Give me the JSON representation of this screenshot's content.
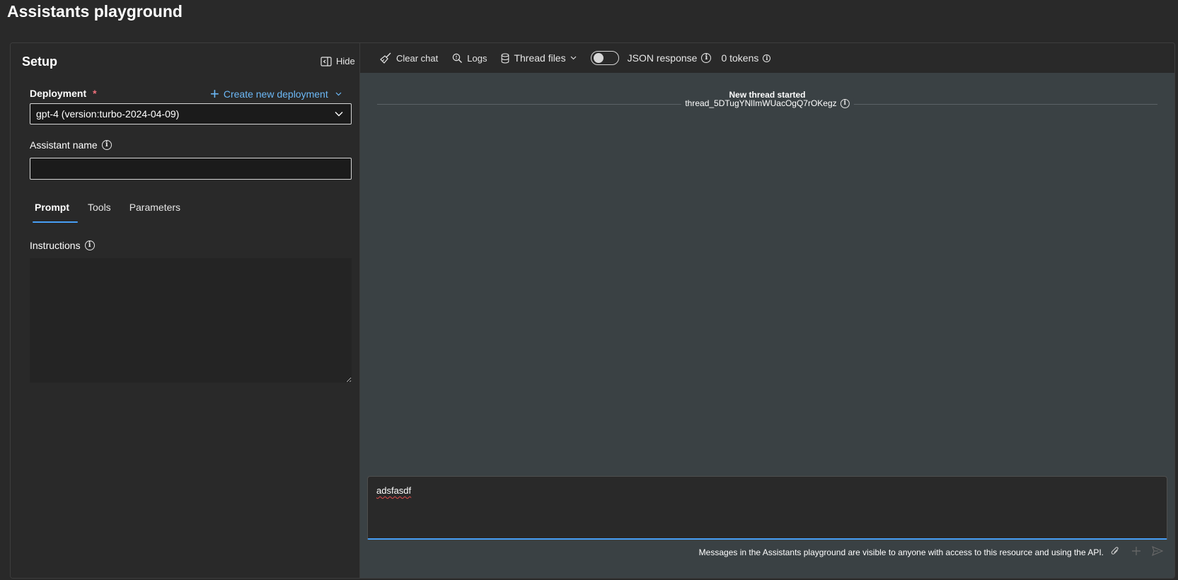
{
  "page": {
    "title": "Assistants playground"
  },
  "setup": {
    "title": "Setup",
    "hide_label": "Hide",
    "deployment": {
      "label": "Deployment",
      "required_mark": "*",
      "create_label": "Create new deployment",
      "selected": "gpt-4 (version:turbo-2024-04-09)"
    },
    "assistant_name": {
      "label": "Assistant name",
      "value": "",
      "placeholder": ""
    },
    "tabs": [
      {
        "label": "Prompt",
        "active": true
      },
      {
        "label": "Tools",
        "active": false
      },
      {
        "label": "Parameters",
        "active": false
      }
    ],
    "instructions": {
      "label": "Instructions",
      "value": ""
    }
  },
  "chat": {
    "toolbar": {
      "clear_chat": "Clear chat",
      "logs": "Logs",
      "thread_files": "Thread files",
      "json_response": "JSON response",
      "json_response_enabled": false,
      "tokens": "0 tokens"
    },
    "thread": {
      "title": "New thread started",
      "id": "thread_5DTugYNlImWUacOgQ7rOKegz"
    },
    "composer": {
      "value": "adsfasdf"
    },
    "footer_note": "Messages in the Assistants playground are visible to anyone with access to this resource and using the API."
  },
  "colors": {
    "accent": "#479ef5",
    "link": "#6cb8f6",
    "required": "#f1707b",
    "chat_bg": "#3a4144"
  }
}
